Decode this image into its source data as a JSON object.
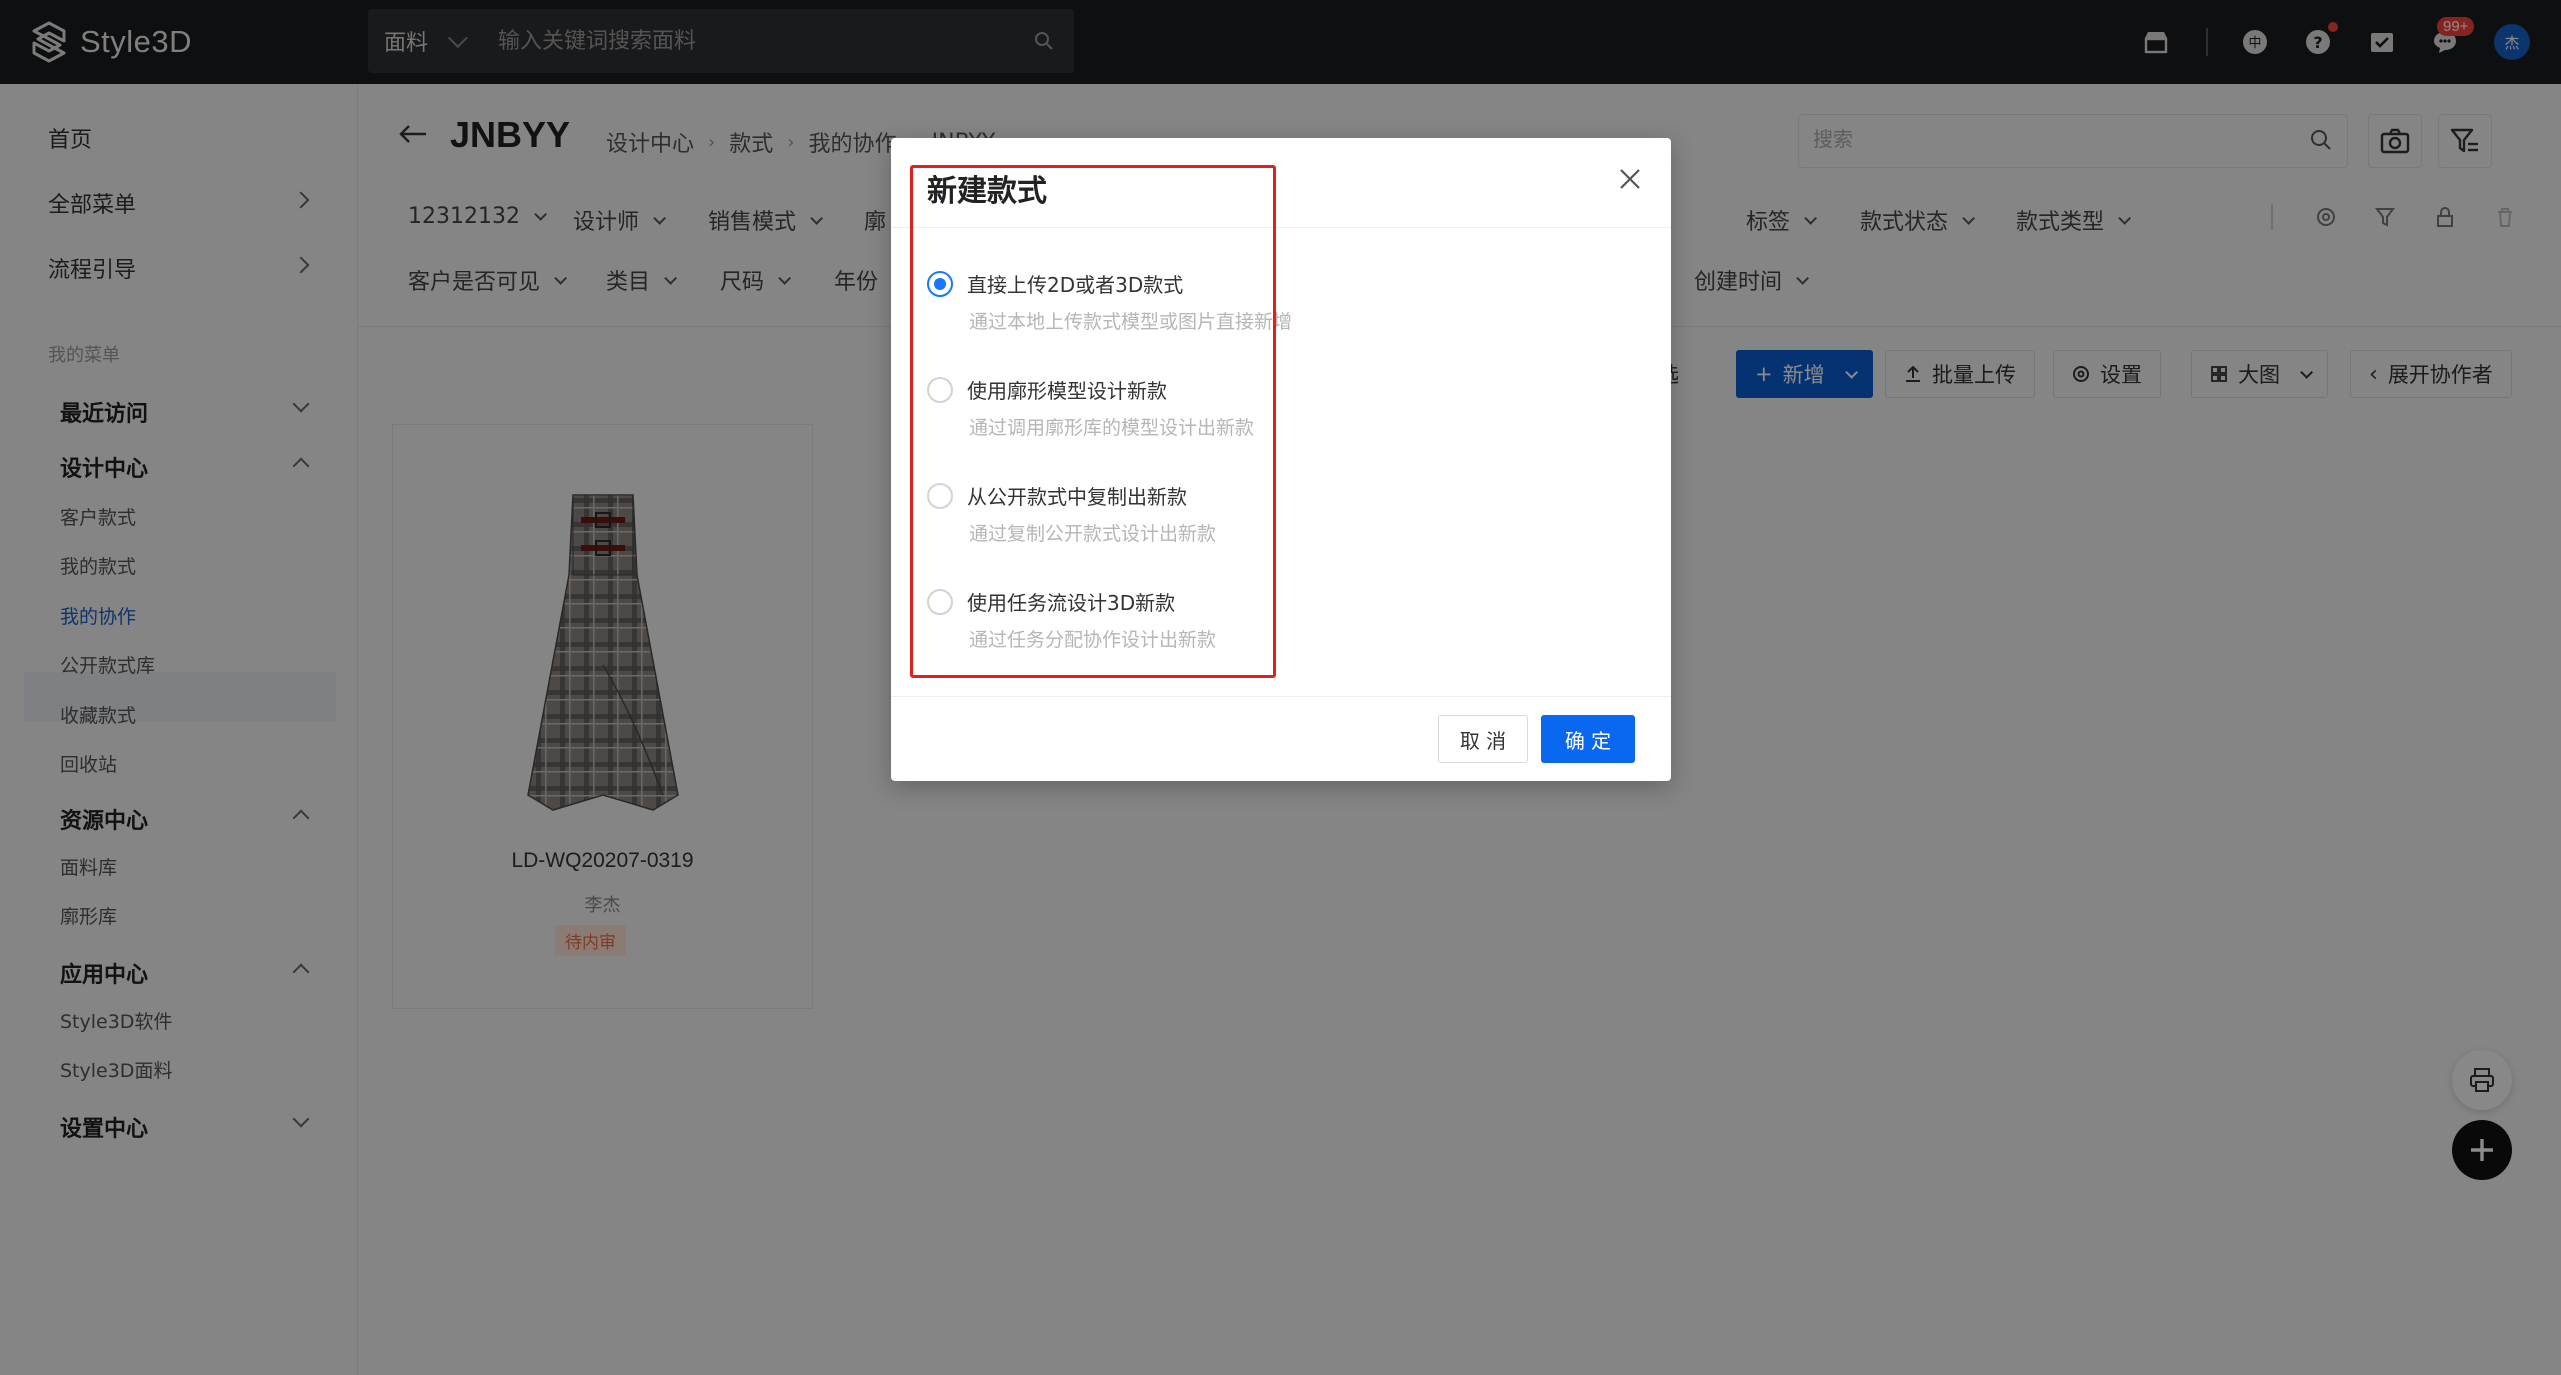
{
  "app": {
    "name": "Style3D"
  },
  "topbar": {
    "search_category": "面料",
    "search_placeholder": "输入关键词搜索面料",
    "message_badge": "99+",
    "avatar_text": "杰"
  },
  "sidebar": {
    "home": "首页",
    "all_menu": "全部菜单",
    "process_guide": "流程引导",
    "my_menu": "我的菜单",
    "recent": "最近访问",
    "design_center": "设计中心",
    "design_items": [
      "客户款式",
      "我的款式",
      "我的协作",
      "公开款式库",
      "收藏款式",
      "回收站"
    ],
    "resource_center": "资源中心",
    "resource_items": [
      "面料库",
      "廓形库"
    ],
    "app_center": "应用中心",
    "app_items": [
      "Style3D软件",
      "Style3D面料"
    ],
    "settings_center": "设置中心"
  },
  "main": {
    "title": "JNBYY",
    "breadcrumbs": [
      "设计中心",
      "款式",
      "我的协作",
      "JNBYY"
    ],
    "search_placeholder": "搜索",
    "filters_row1": [
      "12312132",
      "设计师",
      "销售模式",
      "廓",
      "标签",
      "款式状态",
      "款式类型"
    ],
    "filters_row2": [
      "客户是否可见",
      "类目",
      "尺码",
      "年份",
      "创建时间"
    ],
    "actions": {
      "select": "选",
      "add": "新增",
      "batch_upload": "批量上传",
      "settings": "设置",
      "view": "大图",
      "expand_collaborators": "展开协作者"
    },
    "card": {
      "code": "LD-WQ20207-0319",
      "owner": "李杰",
      "status": "待内审"
    }
  },
  "modal": {
    "title": "新建款式",
    "options": [
      {
        "label": "直接上传2D或者3D款式",
        "desc": "通过本地上传款式模型或图片直接新增",
        "selected": true
      },
      {
        "label": "使用廓形模型设计新款",
        "desc": "通过调用廓形库的模型设计出新款",
        "selected": false
      },
      {
        "label": "从公开款式中复制出新款",
        "desc": "通过复制公开款式设计出新款",
        "selected": false
      },
      {
        "label": "使用任务流设计3D新款",
        "desc": "通过任务分配协作设计出新款",
        "selected": false
      }
    ],
    "cancel": "取 消",
    "ok": "确 定"
  },
  "colors": {
    "primary": "#0a68f0",
    "highlight_box": "#e21f1f",
    "status_tag": "#ee6b3b"
  }
}
